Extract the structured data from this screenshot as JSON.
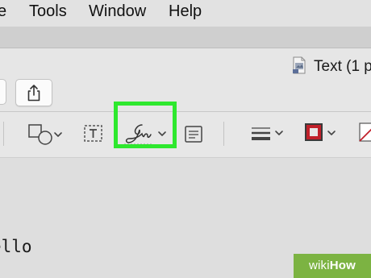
{
  "menubar": {
    "items": [
      "Tools",
      "Window",
      "Help"
    ],
    "partial_item": "e"
  },
  "window": {
    "doc_title": "Text (1 p",
    "doc_icon": "document-icon",
    "share_icon": "share-icon"
  },
  "toolbar": {
    "tools": [
      {
        "icon": "shapes-icon",
        "label": "Shapes",
        "has_menu": true
      },
      {
        "icon": "text-box-icon",
        "label": "Text"
      },
      {
        "icon": "signature-icon",
        "label": "Sign",
        "has_menu": true,
        "highlighted": true
      },
      {
        "icon": "note-icon",
        "label": "Note"
      },
      {
        "icon": "line-style-icon",
        "label": "Shape Style",
        "has_menu": true
      },
      {
        "icon": "border-color-icon",
        "label": "Border Color",
        "has_menu": true
      },
      {
        "icon": "fill-color-icon",
        "label": "Fill Color"
      }
    ],
    "highlight_color": "#2ee82e",
    "border_color": "#c0202a"
  },
  "document": {
    "text": "ello"
  },
  "watermark": {
    "prefix": "wiki",
    "suffix": "How",
    "color": "#7cb342"
  }
}
